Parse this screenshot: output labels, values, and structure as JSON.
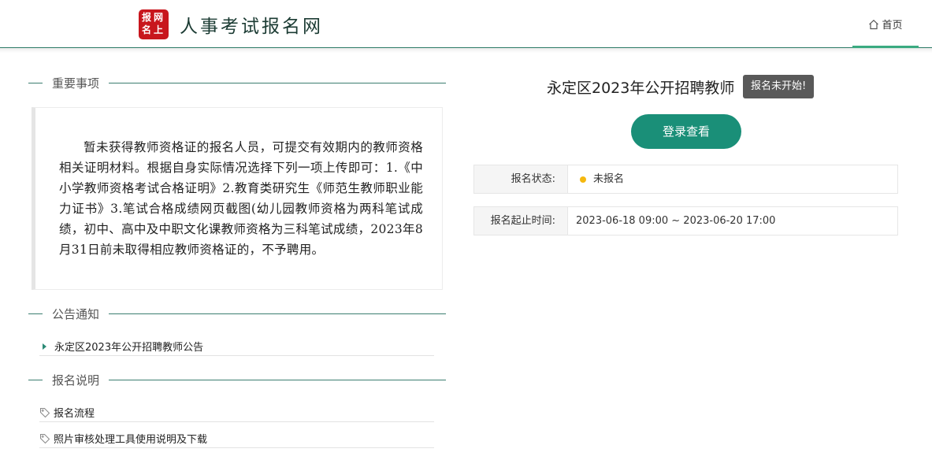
{
  "header": {
    "logo_chars": [
      "报",
      "网",
      "名",
      "上"
    ],
    "site_title": "人事考试报名网",
    "nav_home": "首页",
    "accent_color": "#2b7a66"
  },
  "left": {
    "important": {
      "title": "重要事项",
      "notice": "暂未获得教师资格证的报名人员，可提交有效期内的教师资格相关证明材料。根据自身实际情况选择下列一项上传即可：1.《中小学教师资格考试合格证明》2.教育类研究生《师范生教师职业能力证书》3.笔试合格成绩网页截图(幼儿园教师资格为两科笔试成绩，初中、高中及中职文化课教师资格为三科笔试成绩，2023年8月31日前未取得相应教师资格证的，不予聘用。"
    },
    "announcements": {
      "title": "公告通知",
      "items": [
        "永定区2023年公开招聘教师公告"
      ]
    },
    "guide": {
      "title": "报名说明",
      "items": [
        "报名流程",
        "照片审核处理工具使用说明及下载"
      ]
    }
  },
  "right": {
    "exam_title": "永定区2023年公开招聘教师",
    "status_tip": "报名未开始!",
    "login_button": "登录查看",
    "status_label": "报名状态:",
    "status_value": "未报名",
    "status_color": "#f5b80f",
    "period_label": "报名起止时间:",
    "period_value": "2023-06-18 09:00 ~ 2023-06-20 17:00",
    "button_color": "#1a8f78"
  }
}
